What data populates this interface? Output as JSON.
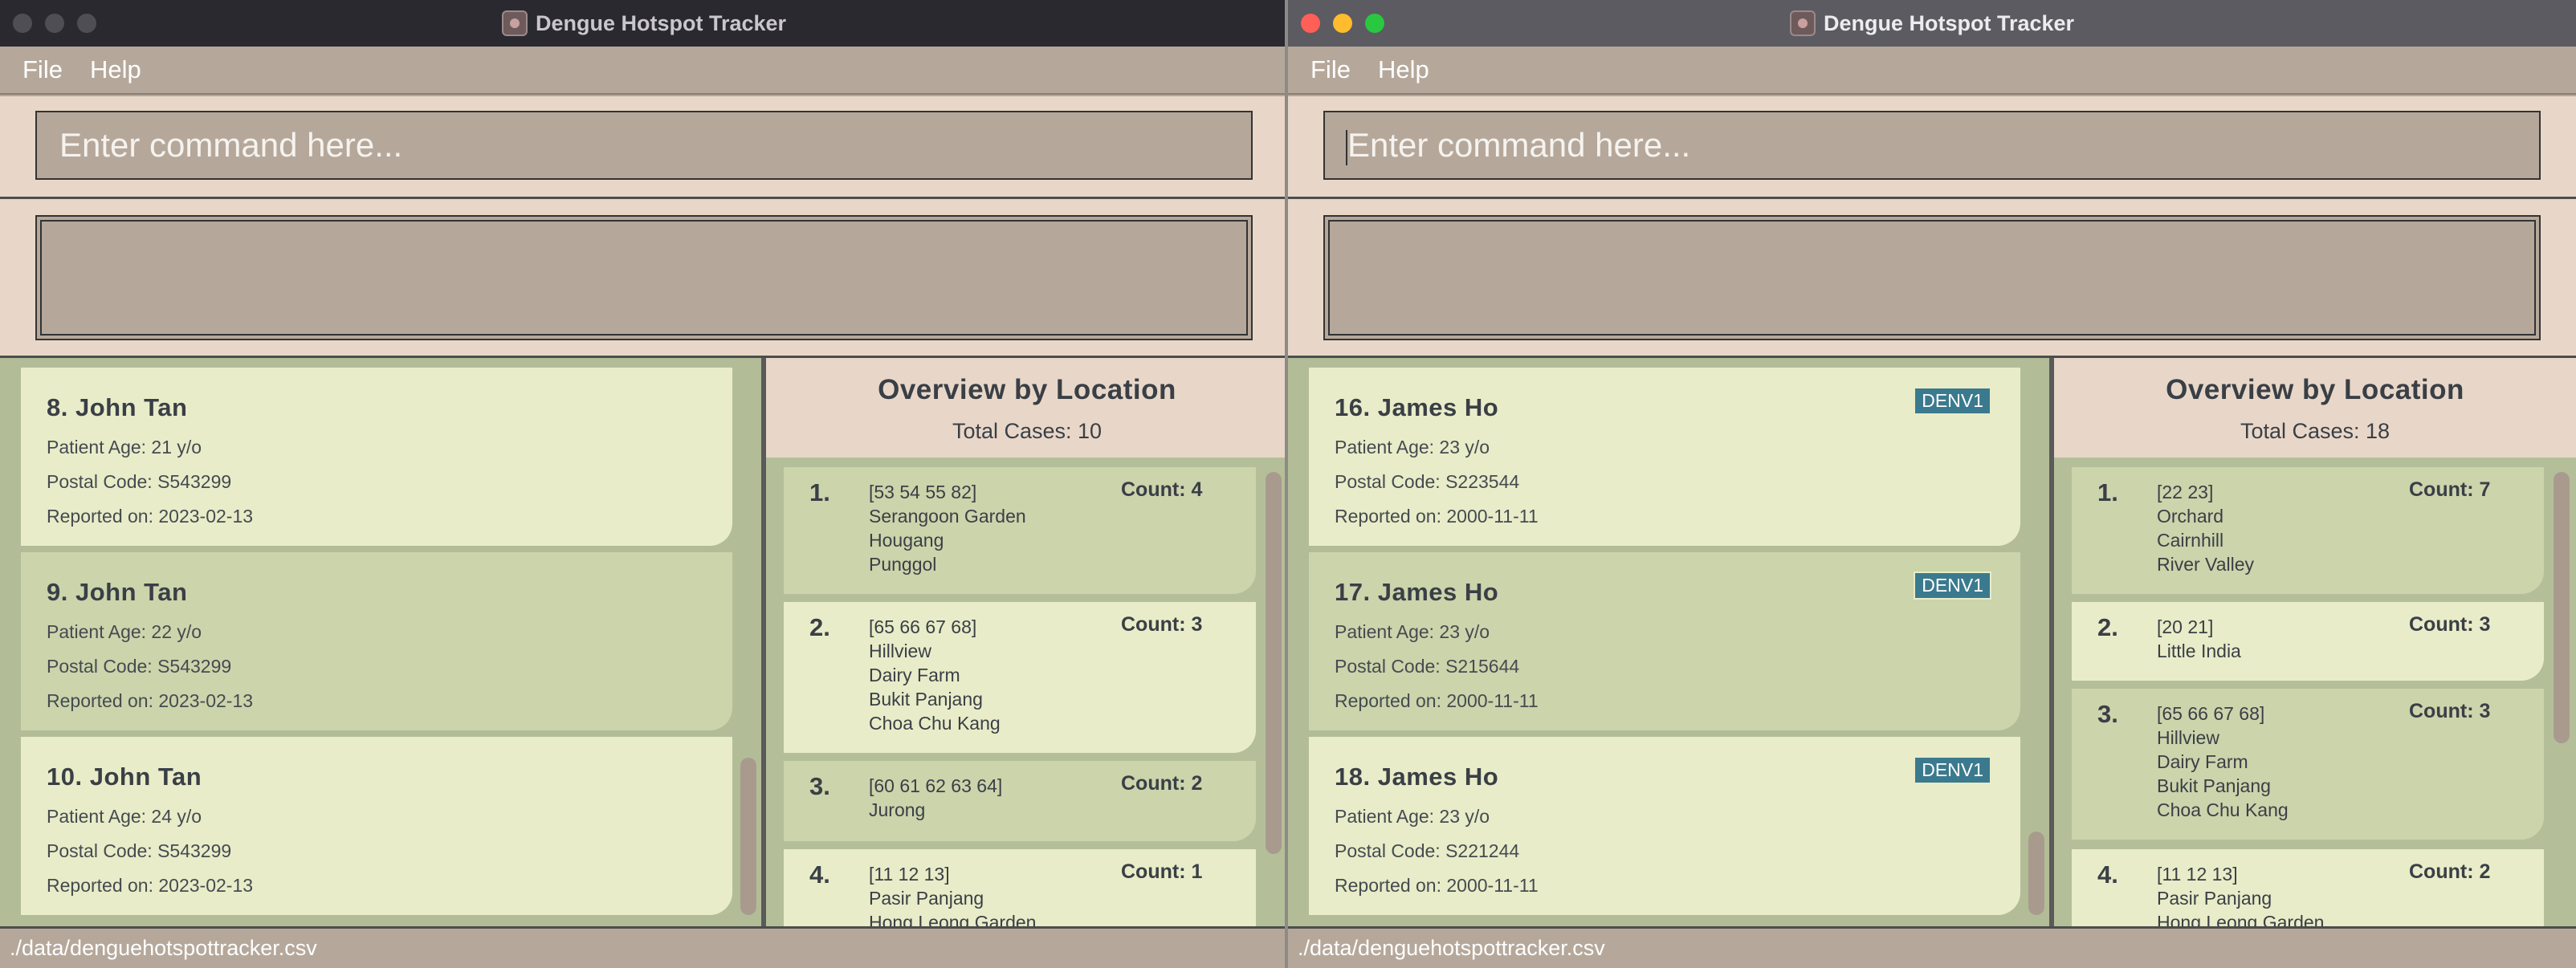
{
  "left": {
    "title": "Dengue Hotspot Tracker",
    "menu": [
      "File",
      "Help"
    ],
    "command_placeholder": "Enter command here...",
    "result_text": "",
    "patients": [
      {
        "name": "8. John Tan",
        "age": "Patient Age: 21 y/o",
        "postal": "Postal Code: S543299",
        "reported": "Reported on: 2023-02-13"
      },
      {
        "name": "9. John Tan",
        "age": "Patient Age: 22 y/o",
        "postal": "Postal Code: S543299",
        "reported": "Reported on: 2023-02-13"
      },
      {
        "name": "10. John Tan",
        "age": "Patient Age: 24 y/o",
        "postal": "Postal Code: S543299",
        "reported": "Reported on: 2023-02-13"
      }
    ],
    "overview": {
      "title": "Overview by Location",
      "total": "Total Cases: 10",
      "items": [
        {
          "num": "1.",
          "lines": [
            "[53 54 55 82]",
            "Serangoon Garden",
            "Hougang",
            "Punggol"
          ],
          "count": "Count: 4"
        },
        {
          "num": "2.",
          "lines": [
            "[65 66 67 68]",
            "Hillview",
            "Dairy Farm",
            "Bukit Panjang",
            "Choa Chu Kang"
          ],
          "count": "Count: 3"
        },
        {
          "num": "3.",
          "lines": [
            "[60 61 62 63 64]",
            "Jurong"
          ],
          "count": "Count: 2"
        },
        {
          "num": "4.",
          "lines": [
            "[11 12 13]",
            "Pasir Panjang",
            "Hong Leong Garden"
          ],
          "count": "Count: 1"
        }
      ]
    },
    "status": "./data/denguehotspottracker.csv"
  },
  "right": {
    "title": "Dengue Hotspot Tracker",
    "menu": [
      "File",
      "Help"
    ],
    "command_placeholder": "Enter command here...",
    "result_text": "",
    "patients": [
      {
        "name": "16. James Ho",
        "age": "Patient Age: 23 y/o",
        "postal": "Postal Code: S223544",
        "reported": "Reported on: 2000-11-11",
        "tag": "DENV1"
      },
      {
        "name": "17. James Ho",
        "age": "Patient Age: 23 y/o",
        "postal": "Postal Code: S215644",
        "reported": "Reported on: 2000-11-11",
        "tag": "DENV1"
      },
      {
        "name": "18. James Ho",
        "age": "Patient Age: 23 y/o",
        "postal": "Postal Code: S221244",
        "reported": "Reported on: 2000-11-11",
        "tag": "DENV1"
      }
    ],
    "overview": {
      "title": "Overview by Location",
      "total": "Total Cases: 18",
      "items": [
        {
          "num": "1.",
          "lines": [
            "[22 23]",
            "Orchard",
            "Cairnhill",
            "River Valley"
          ],
          "count": "Count: 7"
        },
        {
          "num": "2.",
          "lines": [
            "[20 21]",
            "Little India"
          ],
          "count": "Count: 3"
        },
        {
          "num": "3.",
          "lines": [
            "[65 66 67 68]",
            "Hillview",
            "Dairy Farm",
            "Bukit Panjang",
            "Choa Chu Kang"
          ],
          "count": "Count: 3"
        },
        {
          "num": "4.",
          "lines": [
            "[11 12 13]",
            "Pasir Panjang",
            "Hong Leong Garden"
          ],
          "count": "Count: 2"
        }
      ]
    },
    "status": "./data/denguehotspottracker.csv"
  }
}
